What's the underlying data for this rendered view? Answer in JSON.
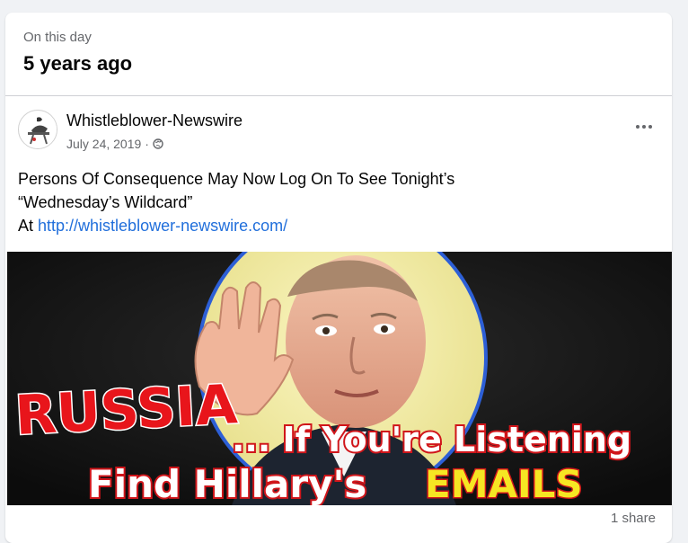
{
  "memory": {
    "label": "On this day",
    "title": "5 years ago"
  },
  "post": {
    "author": "Whistleblower-Newswire",
    "date": "July 24, 2019",
    "separator": "·",
    "privacy_icon": "globe-icon",
    "more_icon": "more-dots-icon",
    "text_line1": "Persons Of Consequence May Now Log On To See Tonight’s",
    "text_line2": "“Wednesday’s Wildcard”",
    "text_at": "At ",
    "link": "http://whistleblower-newswire.com/",
    "image": {
      "headline_red": "RUSSIA",
      "headline_white": "... If You're Listening",
      "line2_white": "Find Hillary's",
      "line2_yellow": "EMAILS"
    },
    "shares": "1 share"
  },
  "colors": {
    "link": "#216fdb",
    "red_text": "#e8151b",
    "yellow_text": "#f6e623",
    "circle_fill": "#f1eb9c",
    "circle_border": "#2d5fd6"
  }
}
